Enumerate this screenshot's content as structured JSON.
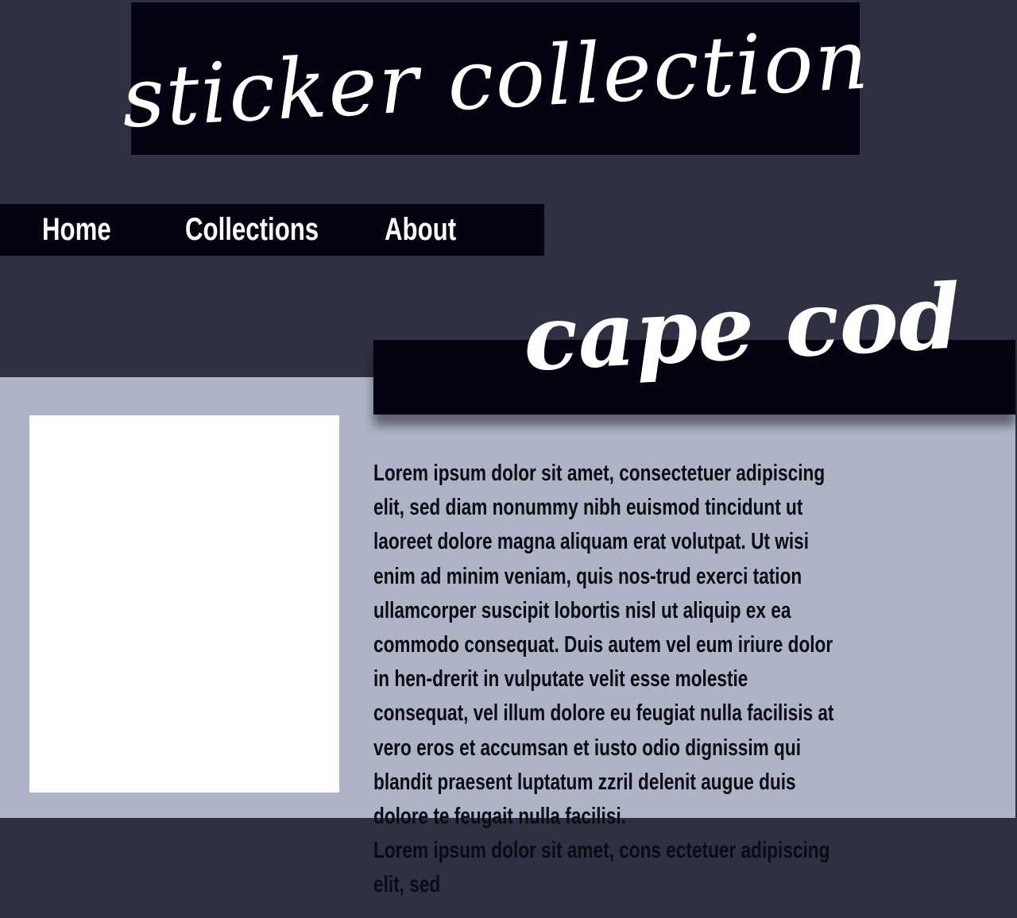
{
  "header": {
    "title": "sticker collection"
  },
  "nav": {
    "items": [
      {
        "label": "Home"
      },
      {
        "label": "Collections"
      },
      {
        "label": "About"
      }
    ]
  },
  "main": {
    "collection_title": "cape cod",
    "paragraphs": [
      "Lorem ipsum dolor sit amet, consectetuer adipiscing elit, sed diam nonummy nibh euismod tincidunt ut laoreet dolore magna aliquam erat volutpat. Ut wisi enim ad minim veniam, quis nos-trud exerci tation ullamcorper suscipit lobortis nisl ut aliquip ex ea commodo consequat. Duis autem vel eum iriure dolor in hen-drerit in vulputate velit esse molestie consequat, vel illum dolore eu feugiat nulla facilisis at vero eros et accumsan et iusto odio dignissim qui blandit praesent luptatum zzril delenit augue duis dolore te feugait nulla facilisi.",
      "Lorem ipsum dolor sit amet, cons ectetuer adipiscing elit, sed"
    ]
  },
  "colors": {
    "page_background": "#2f3042",
    "header_background": "#050212",
    "content_background": "#aeb4c6",
    "image_placeholder": "#ffffff",
    "text_dark": "#0b0b14",
    "text_light": "#ffffff"
  }
}
